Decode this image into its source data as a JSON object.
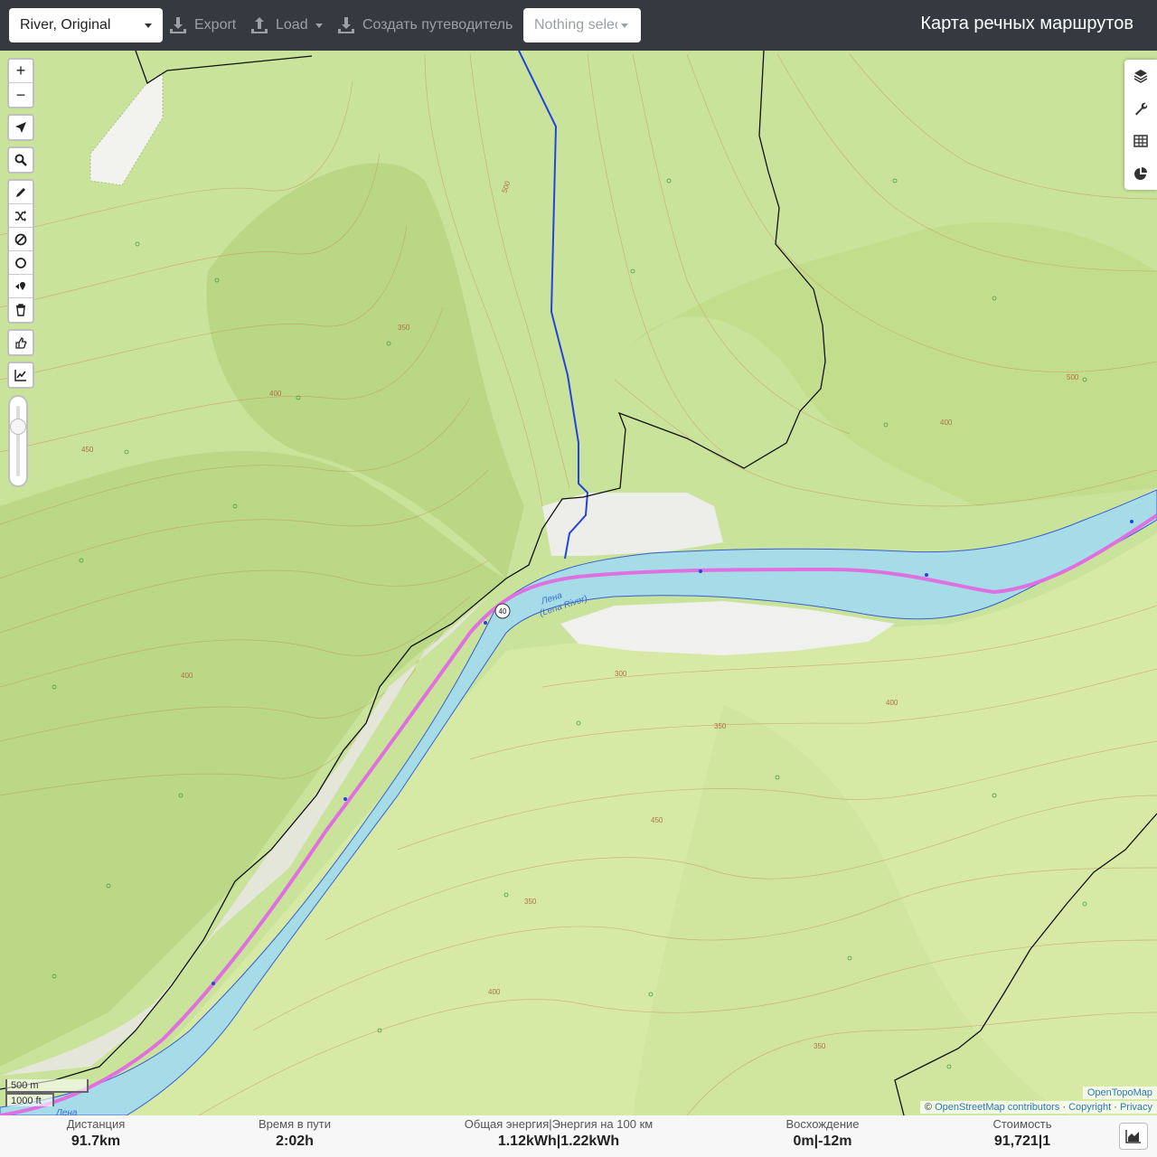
{
  "topbar": {
    "profile": "River, Original",
    "export_label": "Export",
    "load_label": "Load",
    "guide_label": "Создать путеводитель",
    "selection_placeholder": "Nothing selected",
    "app_title": "Карта речных маршрутов"
  },
  "map_controls": {
    "zoom_in": "+",
    "zoom_out": "−"
  },
  "map": {
    "river_name": "Лена",
    "river_name_en": "(Lena River)",
    "road_shield": "40",
    "bottom_river_label": "Лена",
    "contour_labels": [
      "300",
      "350",
      "400",
      "450",
      "500"
    ]
  },
  "scale": {
    "metric": "500 m",
    "imperial": "1000 ft"
  },
  "attribution": {
    "tiles": "OpenTopoMap",
    "osm": "OpenStreetMap contributors",
    "copyright": "Copyright",
    "privacy": "Privacy",
    "prefix": "©",
    "sep": "·"
  },
  "stats": {
    "distance_label": "Дистанция",
    "distance_value": "91.7",
    "distance_unit": "km",
    "time_label": "Время в пути",
    "time_value": "2:02",
    "time_unit": "h",
    "energy_label": "Общая энергия|Энергия на 100 км",
    "energy_total": "1.12",
    "energy_total_unit": "kWh",
    "energy_per100": "1.22",
    "energy_per100_unit": "kWh",
    "ascent_label": "Восхождение",
    "ascent_up": "0",
    "ascent_down": "-12",
    "ascent_unit": "m",
    "cost_label": "Стоимость",
    "cost_value": "91,721",
    "cost_extra": "1"
  },
  "colors": {
    "topbar": "#343a40",
    "terrain": "#c9e39a",
    "water": "#a6dbe8",
    "route": "#e070e0",
    "stream": "#2244dd",
    "contour": "#c98a5a"
  }
}
